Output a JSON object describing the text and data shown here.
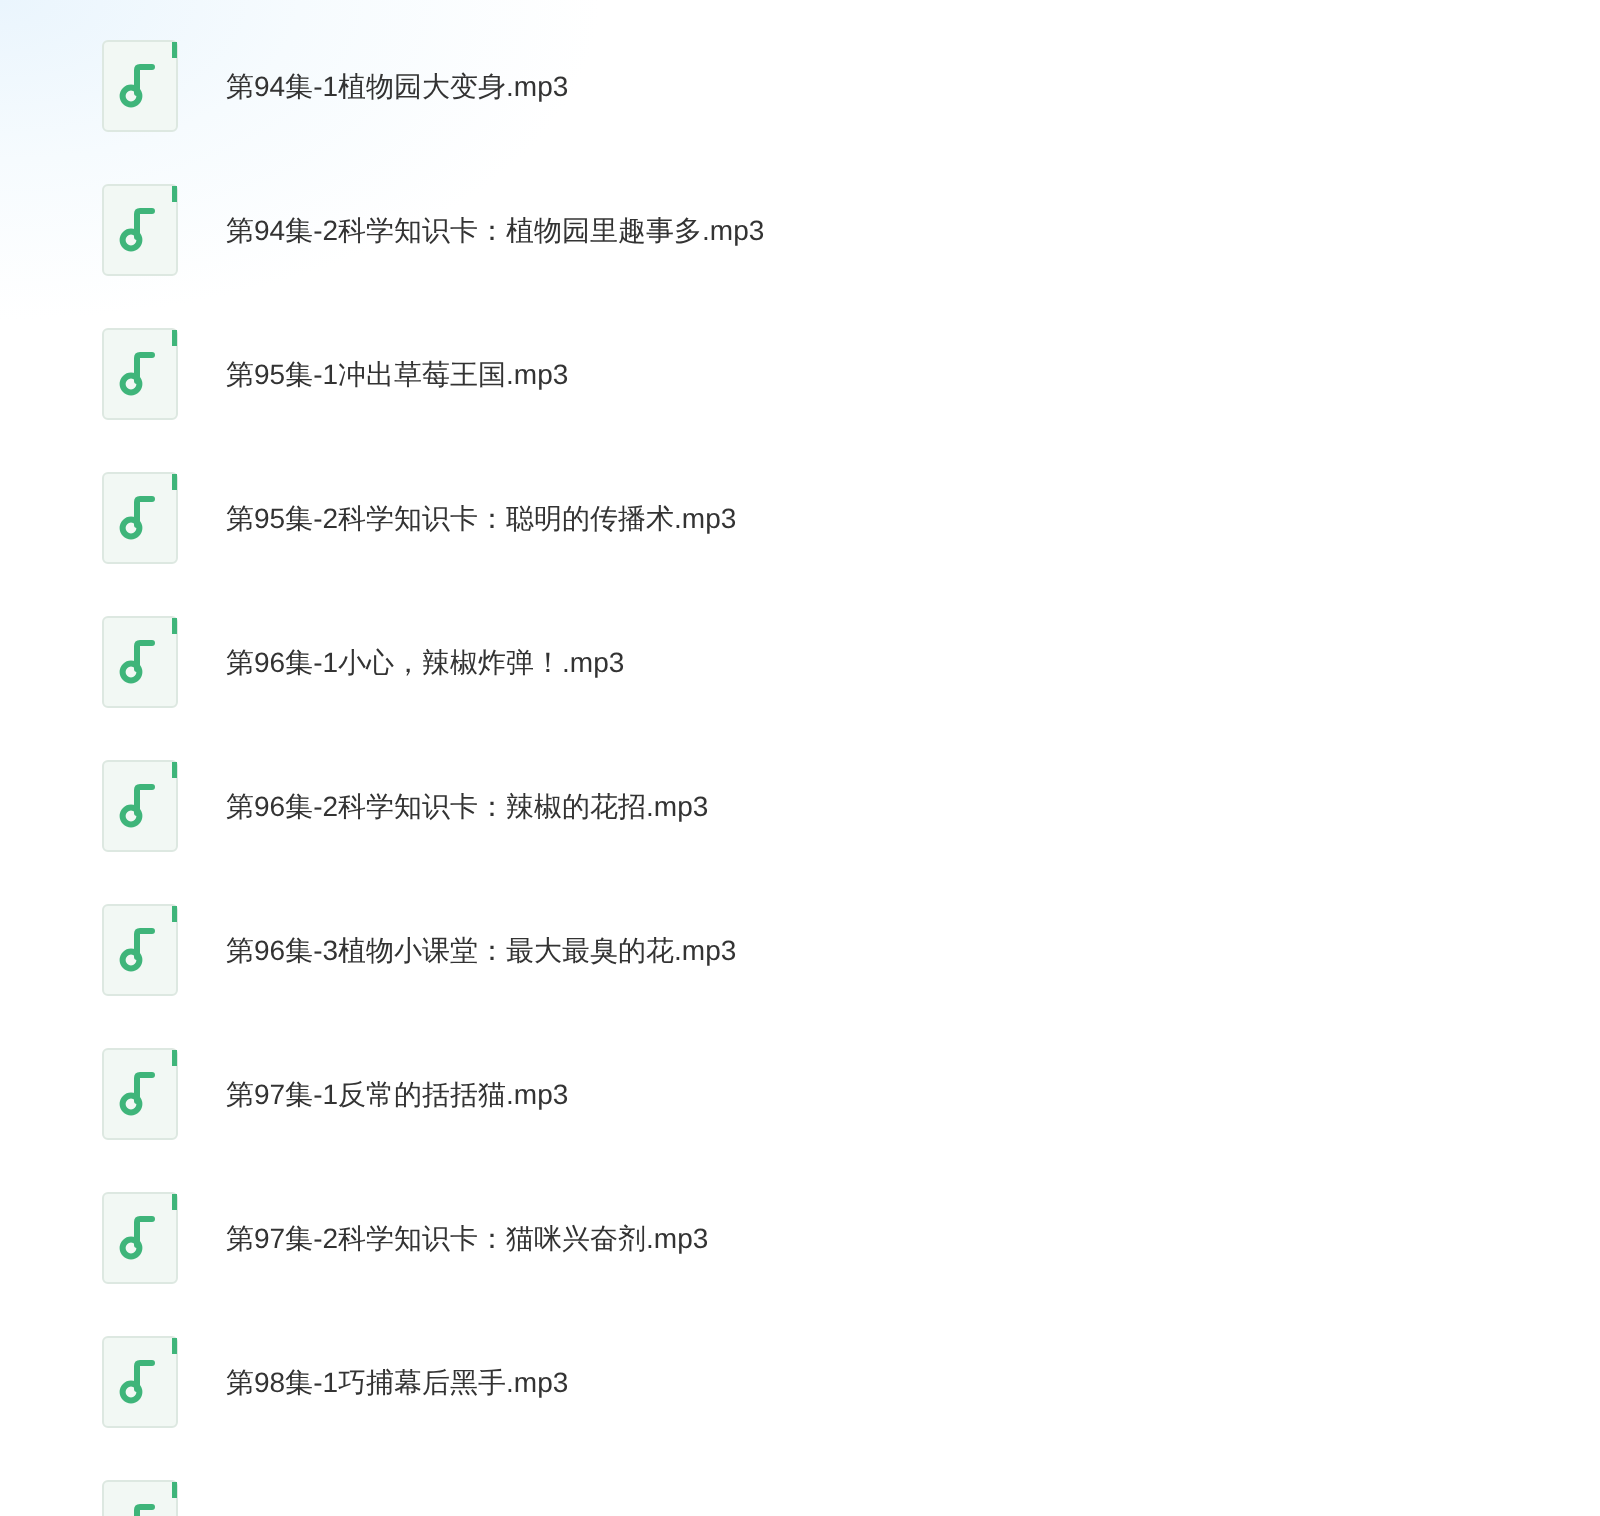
{
  "files": [
    {
      "kind": "audio",
      "name": "第94集-1植物园大变身.mp3"
    },
    {
      "kind": "audio",
      "name": "第94集-2科学知识卡：植物园里趣事多.mp3"
    },
    {
      "kind": "audio",
      "name": "第95集-1冲出草莓王国.mp3"
    },
    {
      "kind": "audio",
      "name": "第95集-2科学知识卡：聪明的传播术.mp3"
    },
    {
      "kind": "audio",
      "name": "第96集-1小心，辣椒炸弹！.mp3"
    },
    {
      "kind": "audio",
      "name": "第96集-2科学知识卡：辣椒的花招.mp3"
    },
    {
      "kind": "audio",
      "name": "第96集-3植物小课堂：最大最臭的花.mp3"
    },
    {
      "kind": "audio",
      "name": "第97集-1反常的括括猫.mp3"
    },
    {
      "kind": "audio",
      "name": "第97集-2科学知识卡：猫咪兴奋剂.mp3"
    },
    {
      "kind": "audio",
      "name": "第98集-1巧捕幕后黑手.mp3"
    },
    {
      "kind": "audio"
    }
  ]
}
